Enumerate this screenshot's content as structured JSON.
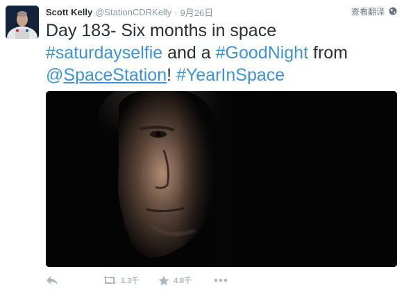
{
  "tweet": {
    "author": {
      "full_name": "Scott Kelly",
      "username": "@StationCDRKelly"
    },
    "separator": "·",
    "timestamp": "9月26日",
    "translate_label": "查看翻译",
    "text": {
      "line1": "Day 183- Six months in space",
      "hashtag1": "#saturdayselfie",
      "mid1": " and a ",
      "hashtag2": "#GoodNight",
      "mid2": " from",
      "mention_at": "@",
      "mention_name": "SpaceStation",
      "mid3": "! ",
      "hashtag3": "#YearInSpace"
    },
    "stats": {
      "retweets": "1.3千",
      "favorites": "4.8千"
    }
  },
  "icons": {
    "avatar": "astronaut-avatar",
    "globe": "globe-icon",
    "reply": "reply-icon",
    "retweet": "retweet-icon",
    "favorite": "star-icon",
    "more": "ellipsis-icon"
  },
  "colors": {
    "link": "#3b94d9",
    "text": "#292f33",
    "muted": "#8899a6",
    "action": "#aab8c2"
  }
}
